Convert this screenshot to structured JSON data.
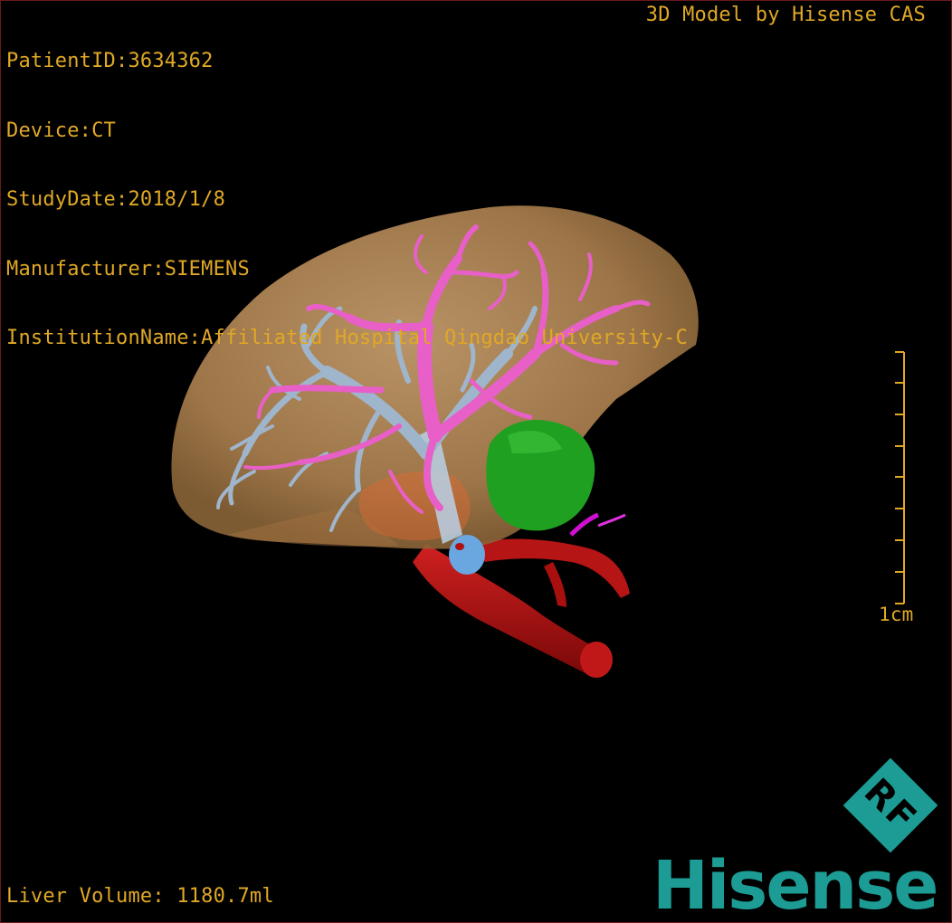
{
  "header": {
    "patient_id": "PatientID:3634362",
    "device": "Device:CT",
    "study_date": "StudyDate:2018/1/8",
    "manufacturer": "Manufacturer:SIEMENS",
    "institution": "InstitutionName:Affiliated Hospital Qingdao University-C"
  },
  "brand_top": "3D Model by Hisense CAS",
  "footer": {
    "liver_volume": "Liver Volume: 1180.7ml"
  },
  "scale_bar": {
    "label": "1cm"
  },
  "logo": {
    "badge_text": "RF",
    "brand_text": "Hisense"
  },
  "colors": {
    "overlay_text": "#e0a825",
    "liver": "#c89a63",
    "hepatic_vein": "#e85fc8",
    "portal_vein": "#9fb5cc",
    "artery": "#b01010",
    "gallbladder": "#22b022",
    "ivc": "#6aa6e0",
    "brand": "#1d9c95"
  }
}
